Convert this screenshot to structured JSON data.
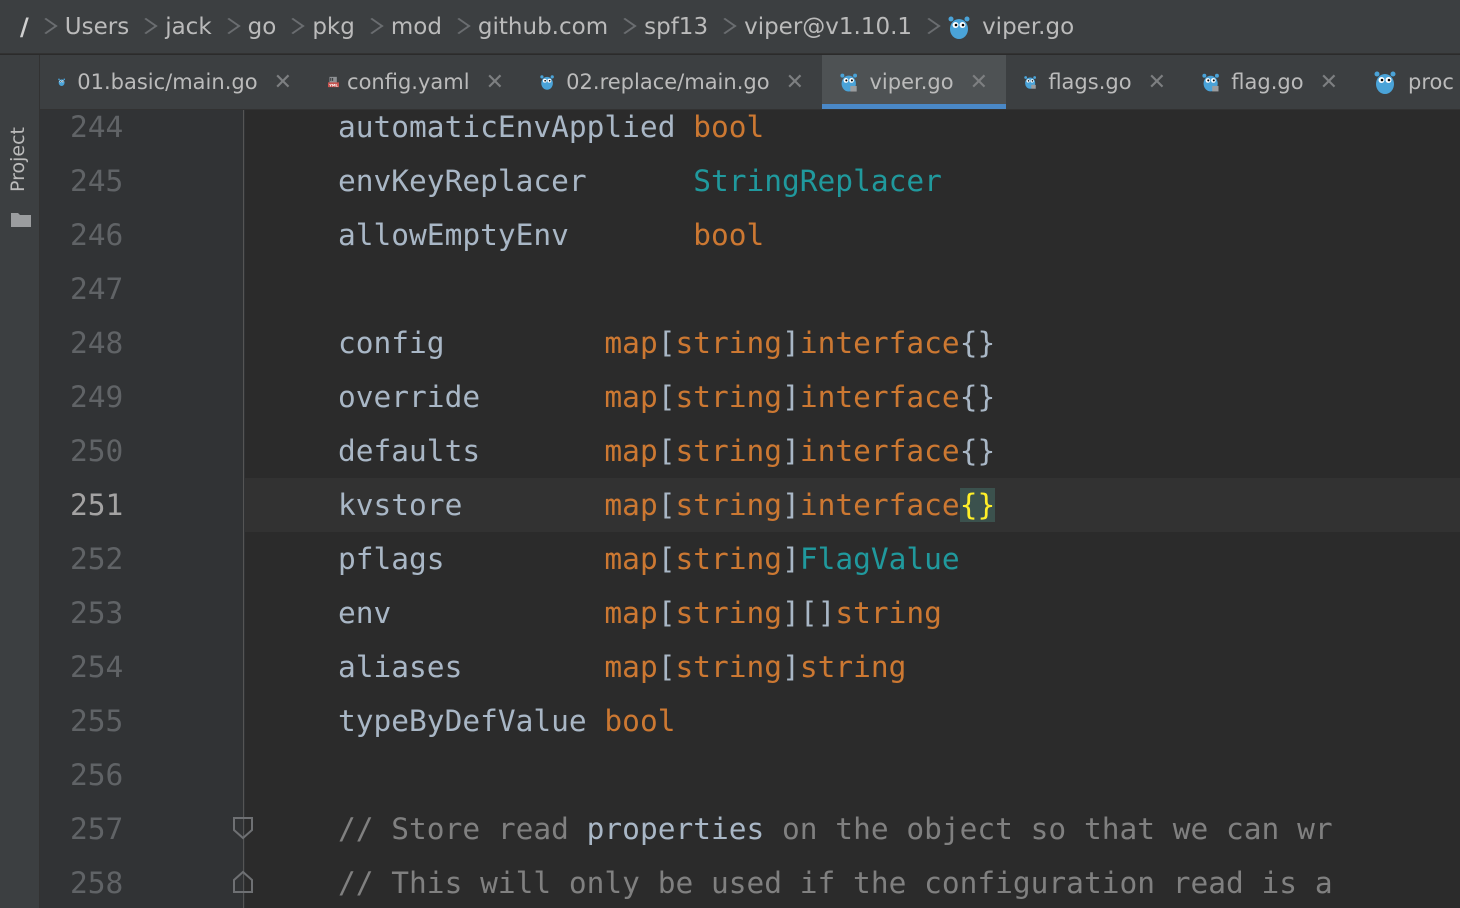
{
  "breadcrumb": {
    "root": "/",
    "items": [
      "Users",
      "jack",
      "go",
      "pkg",
      "mod",
      "github.com",
      "spf13",
      "viper@v1.10.1"
    ],
    "file": "viper.go"
  },
  "sidebar": {
    "project_label": "Project"
  },
  "tabs": [
    {
      "label": "01.basic/main.go",
      "icon": "gopher-icon",
      "active": false
    },
    {
      "label": "config.yaml",
      "icon": "yaml-icon",
      "active": false
    },
    {
      "label": "02.replace/main.go",
      "icon": "gopher-icon",
      "active": false
    },
    {
      "label": "viper.go",
      "icon": "gopher-lock-icon",
      "active": true
    },
    {
      "label": "flags.go",
      "icon": "gopher-lock-icon",
      "active": false
    },
    {
      "label": "flag.go",
      "icon": "gopher-lock-icon",
      "active": false
    },
    {
      "label": "proc",
      "icon": "gopher-icon",
      "active": false
    }
  ],
  "colors": {
    "keyword": "#cc7832",
    "type": "#20999d",
    "identifier": "#a9b7c6",
    "comment": "#808080",
    "tab_underline": "#4a88c7",
    "brace_match": "#ffef28"
  },
  "editor": {
    "current_line": 251,
    "lines": [
      {
        "num": "244",
        "field": "automaticEnvApplied",
        "pad": " ",
        "type": [
          {
            "t": "bool",
            "c": "kw"
          }
        ]
      },
      {
        "num": "245",
        "field": "envKeyReplacer",
        "pad": "      ",
        "type": [
          {
            "t": "StringReplacer",
            "c": "ty"
          }
        ]
      },
      {
        "num": "246",
        "field": "allowEmptyEnv",
        "pad": "       ",
        "type": [
          {
            "t": "bool",
            "c": "kw"
          }
        ]
      },
      {
        "num": "247",
        "field": "",
        "pad": "",
        "type": []
      },
      {
        "num": "248",
        "field": "config",
        "pad": "         ",
        "type": [
          {
            "t": "map",
            "c": "kw"
          },
          {
            "t": "[",
            "c": "id"
          },
          {
            "t": "string",
            "c": "kw"
          },
          {
            "t": "]",
            "c": "id"
          },
          {
            "t": "interface",
            "c": "kw"
          },
          {
            "t": "{}",
            "c": "id"
          }
        ]
      },
      {
        "num": "249",
        "field": "override",
        "pad": "       ",
        "type": [
          {
            "t": "map",
            "c": "kw"
          },
          {
            "t": "[",
            "c": "id"
          },
          {
            "t": "string",
            "c": "kw"
          },
          {
            "t": "]",
            "c": "id"
          },
          {
            "t": "interface",
            "c": "kw"
          },
          {
            "t": "{}",
            "c": "id"
          }
        ]
      },
      {
        "num": "250",
        "field": "defaults",
        "pad": "       ",
        "type": [
          {
            "t": "map",
            "c": "kw"
          },
          {
            "t": "[",
            "c": "id"
          },
          {
            "t": "string",
            "c": "kw"
          },
          {
            "t": "]",
            "c": "id"
          },
          {
            "t": "interface",
            "c": "kw"
          },
          {
            "t": "{}",
            "c": "id"
          }
        ]
      },
      {
        "num": "251",
        "field": "kvstore",
        "pad": "        ",
        "type": [
          {
            "t": "map",
            "c": "kw"
          },
          {
            "t": "[",
            "c": "id"
          },
          {
            "t": "string",
            "c": "kw"
          },
          {
            "t": "]",
            "c": "id"
          },
          {
            "t": "interface",
            "c": "kw"
          },
          {
            "t": "{}",
            "c": "hl"
          }
        ]
      },
      {
        "num": "252",
        "field": "pflags",
        "pad": "         ",
        "type": [
          {
            "t": "map",
            "c": "kw"
          },
          {
            "t": "[",
            "c": "id"
          },
          {
            "t": "string",
            "c": "kw"
          },
          {
            "t": "]",
            "c": "id"
          },
          {
            "t": "FlagValue",
            "c": "ty"
          }
        ]
      },
      {
        "num": "253",
        "field": "env",
        "pad": "            ",
        "type": [
          {
            "t": "map",
            "c": "kw"
          },
          {
            "t": "[",
            "c": "id"
          },
          {
            "t": "string",
            "c": "kw"
          },
          {
            "t": "][]",
            "c": "id"
          },
          {
            "t": "string",
            "c": "kw"
          }
        ]
      },
      {
        "num": "254",
        "field": "aliases",
        "pad": "        ",
        "type": [
          {
            "t": "map",
            "c": "kw"
          },
          {
            "t": "[",
            "c": "id"
          },
          {
            "t": "string",
            "c": "kw"
          },
          {
            "t": "]",
            "c": "id"
          },
          {
            "t": "string",
            "c": "kw"
          }
        ]
      },
      {
        "num": "255",
        "field": "typeByDefValue",
        "pad": " ",
        "type": [
          {
            "t": "bool",
            "c": "kw"
          }
        ]
      },
      {
        "num": "256",
        "field": "",
        "pad": "",
        "type": []
      },
      {
        "num": "257",
        "comment": [
          {
            "t": "// Store read ",
            "c": "cm"
          },
          {
            "t": "properties",
            "c": "em"
          },
          {
            "t": " on the object so that we can wr",
            "c": "cm"
          }
        ]
      },
      {
        "num": "258",
        "comment": [
          {
            "t": "// This will only be used if the configuration read is a",
            "c": "cm"
          }
        ]
      }
    ]
  }
}
